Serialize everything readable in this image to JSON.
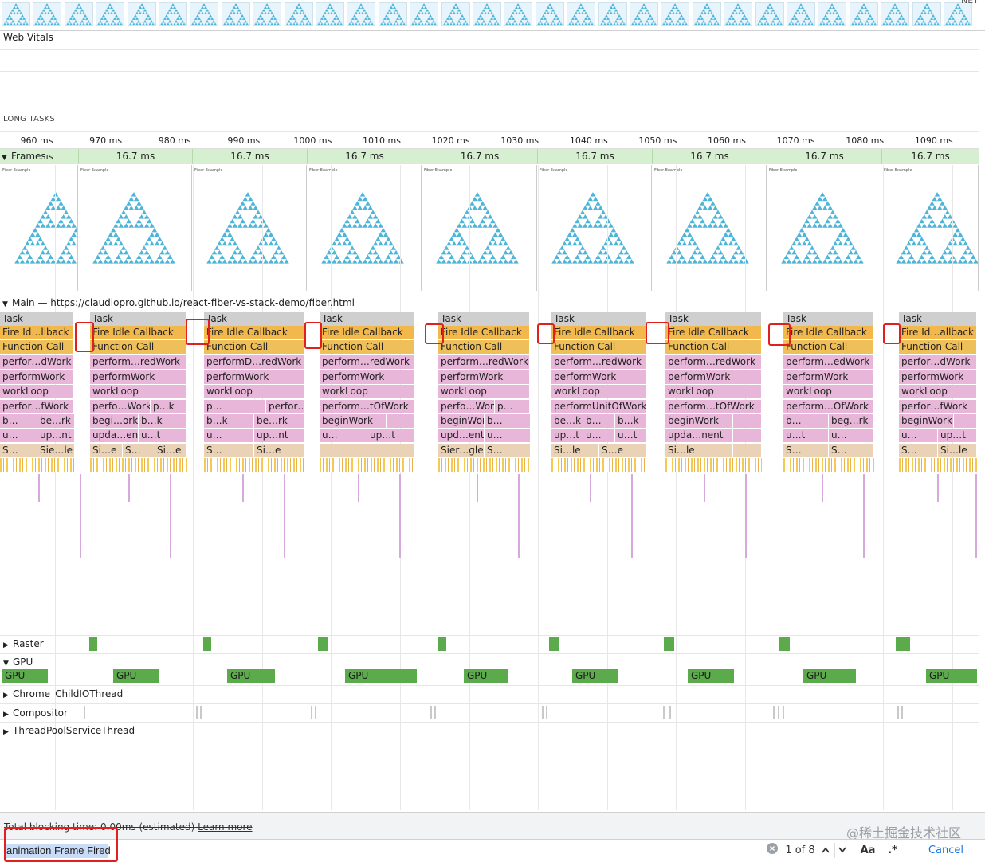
{
  "top_strip": {
    "thumb_count": 31
  },
  "tracks": {
    "web_vitals": "Web Vitals",
    "long_tasks": "LONG TASKS"
  },
  "ruler": {
    "ticks": [
      "960 ms",
      "970 ms",
      "980 ms",
      "990 ms",
      "1000 ms",
      "1010 ms",
      "1020 ms",
      "1030 ms",
      "1040 ms",
      "1050 ms",
      "1060 ms",
      "1070 ms",
      "1080 ms",
      "1090 ms"
    ]
  },
  "frames": {
    "label": "Frames",
    "partial_first": "ıs",
    "durations": [
      "16.7 ms",
      "16.7 ms",
      "16.7 ms",
      "16.7 ms",
      "16.7 ms",
      "16.7 ms",
      "16.7 ms",
      "16.7 ms"
    ],
    "screenshot_caption": "Fiber Example"
  },
  "main": {
    "title": "Main — https://claudiopro.github.io/react-fiber-vs-stack-demo/fiber.html",
    "blocks": [
      {
        "task": "Task",
        "fire": "Fire Id…llback",
        "func": "Function Call",
        "l1": "perfor…dWork",
        "l2": "performWork",
        "l3": "workLoop",
        "l4": "perfor…fWork",
        "l5a": "b…",
        "l5b": "be…rk",
        "l6a": "u…",
        "l6b": "up…nt",
        "l7a": "S…",
        "l7b": "Sie…le"
      },
      {
        "task": "Task",
        "fire": "Fire Idle Callback",
        "func": "Function Call",
        "l1": "perform…redWork",
        "l2": "performWork",
        "l3": "workLoop",
        "l4": "perfo…Work",
        "l4b": "p…k",
        "l5a": "begi…ork",
        "l5b": "b…k",
        "l6a": "upda…ent",
        "l6b": "u…t",
        "l7a": "Si…e",
        "l7b": "S…",
        "l7c": "Si…e"
      },
      {
        "task": "Task",
        "fire": "Fire Idle Callback",
        "func": "Function Call",
        "l1": "performD…redWork",
        "l2": "performWork",
        "l3": "workLoop",
        "l4": "p…",
        "l4b": "perfor…fWork",
        "l5a": "b…k",
        "l5b": "be…rk",
        "l6a": "u…",
        "l6b": "up…nt",
        "l7a": "S…",
        "l7b": "Si…e"
      },
      {
        "task": "Task",
        "fire": "Fire Idle Callback",
        "func": "Function Call",
        "l1": "perform…redWork",
        "l2": "performWork",
        "l3": "workLoop",
        "l4": "perform…tOfWork",
        "l5a": "beginWork",
        "l6a": "u…",
        "l6b": "up…t"
      },
      {
        "task": "Task",
        "fire": "Fire Idle Callback",
        "func": "Function Call",
        "l1": "perform…redWork",
        "l2": "performWork",
        "l3": "workLoop",
        "l4": "perfo…Work",
        "l4b": "p…",
        "l5a": "beginWork",
        "l5b": "b…",
        "l6a": "upd…ent",
        "l6b": "u…",
        "l7a": "Sier…gle",
        "l7b": "S…"
      },
      {
        "task": "Task",
        "fire": "Fire Idle Callback",
        "func": "Function Call",
        "l1": "perform…redWork",
        "l2": "performWork",
        "l3": "workLoop",
        "l4": "performUnitOfWork",
        "l5a": "be…k",
        "l5b": "b…",
        "l5c": "b…k",
        "l6a": "up…t",
        "l6b": "u…",
        "l6c": "u…t",
        "l7a": "Si…le",
        "l7b": "S…e"
      },
      {
        "task": "Task",
        "fire": "Fire Idle Callback",
        "func": "Function Call",
        "l1": "perform…redWork",
        "l2": "performWork",
        "l3": "workLoop",
        "l4": "perform…tOfWork",
        "l5a": "beginWork",
        "l6a": "upda…nent",
        "l7a": "Si…le"
      },
      {
        "task": "Task",
        "fire": "Fire Idle Callback",
        "func": "Function Call",
        "l1": "perform…edWork",
        "l2": "performWork",
        "l3": "workLoop",
        "l4": "perform…OfWork",
        "l5a": "b…",
        "l5b": "beg…rk",
        "l6a": "u…t",
        "l6b": "u…",
        "l7a": "S…",
        "l7b": "S…"
      },
      {
        "task": "Task",
        "fire": "Fire Id…allback",
        "func": "Function Call",
        "l1": "perfor…dWork",
        "l2": "performWork",
        "l3": "workLoop",
        "l4": "perfor…fWork",
        "l5a": "beginWork",
        "l6a": "u…",
        "l6b": "up…t",
        "l7a": "S…",
        "l7b": "Si…le"
      }
    ]
  },
  "threads": {
    "raster": "Raster",
    "gpu": "GPU",
    "gpu_block": "GPU",
    "child_io": "Chrome_ChildIOThread",
    "compositor": "Compositor",
    "threadpool": "ThreadPoolServiceThread"
  },
  "status": {
    "tbt_prefix": "Total blocking time: 0.00ms (estimated)",
    "learn_more": "Learn more",
    "watermark": "@稀土掘金技术社区"
  },
  "search": {
    "value": "animation Frame Fired",
    "match_count": "1 of 8",
    "match_case": "Aa",
    "regex": ".*",
    "cancel": "Cancel"
  },
  "colors": {
    "task": "#cfcfcf",
    "fire_idle": "#f2b84b",
    "scripting_pink": "#e8b6d9",
    "frames_green": "#d7efd1",
    "gpu_green": "#5bab4c",
    "highlight_red": "#e0201e"
  }
}
